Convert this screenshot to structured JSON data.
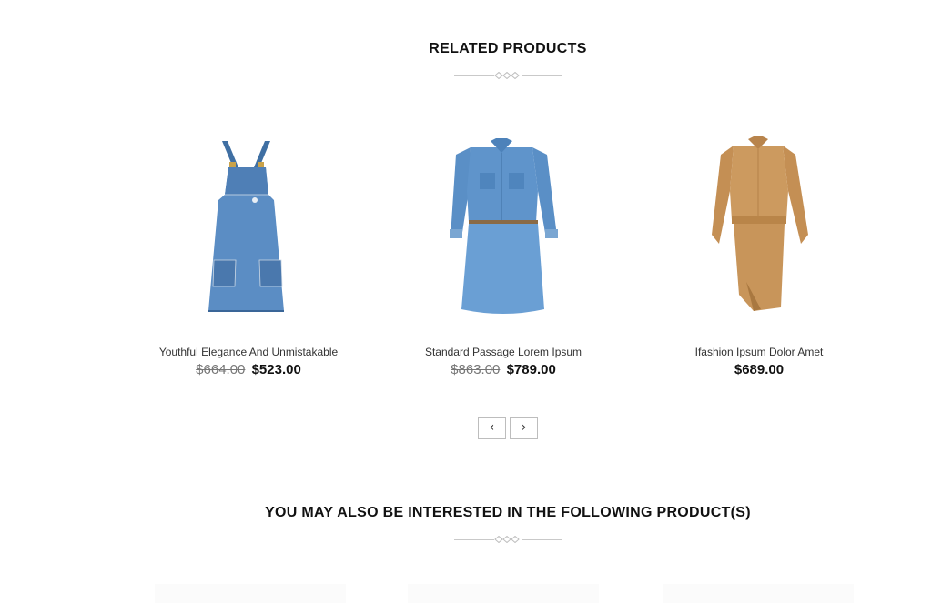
{
  "related": {
    "title": "RELATED PRODUCTS",
    "products": [
      {
        "name": "Youthful Elegance And Unmistakable",
        "old_price": "$664.00",
        "price": "$523.00",
        "image": "denim-overall-dress"
      },
      {
        "name": "Standard Passage Lorem Ipsum",
        "old_price": "$863.00",
        "price": "$789.00",
        "image": "denim-shirt-dress"
      },
      {
        "name": "Ifashion Ipsum Dolor Amet",
        "old_price": "",
        "price": "$689.00",
        "image": "tan-blouse-skirt"
      }
    ],
    "prev_label": "‹",
    "next_label": "›"
  },
  "interested": {
    "title": "YOU MAY ALSO BE INTERESTED IN THE FOLLOWING PRODUCT(S)"
  },
  "colors": {
    "denim": "#4a7fb8",
    "tan": "#c8955a",
    "divider": "#c9c9c9"
  }
}
